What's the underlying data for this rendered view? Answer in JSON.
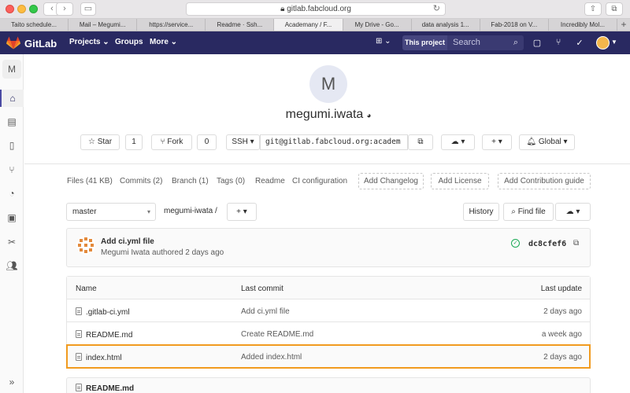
{
  "browser": {
    "url": "gitlab.fabcloud.org",
    "tabs": [
      {
        "label": "Taito schedule...",
        "active": false
      },
      {
        "label": "Mail – Megumi...",
        "active": false
      },
      {
        "label": "https://service...",
        "active": false
      },
      {
        "label": "Readme · Ssh...",
        "active": false
      },
      {
        "label": "Academany / F...",
        "active": true
      },
      {
        "label": "My Drive - Go...",
        "active": false
      },
      {
        "label": "data analysis 1...",
        "active": false
      },
      {
        "label": "Fab-2018 on V...",
        "active": false
      },
      {
        "label": "Incredibly Mol...",
        "active": false
      }
    ]
  },
  "header": {
    "brand": "GitLab",
    "nav": [
      "Projects ⌄",
      "Groups",
      "More ⌄"
    ],
    "scope": "This project",
    "search_placeholder": "Search"
  },
  "sidebar": {
    "avatar_letter": "M"
  },
  "project": {
    "avatar_letter": "M",
    "name": "megumi.iwata",
    "star_label": "Star",
    "star_count": "1",
    "fork_label": "Fork",
    "fork_count": "0",
    "protocol": "SSH",
    "clone_url": "git@gitlab.fabcloud.org:academ",
    "notification": "Global"
  },
  "stats": {
    "files": "Files (41 KB)",
    "commits": "Commits (2)",
    "branch": "Branch (1)",
    "tags": "Tags (0)",
    "readme": "Readme",
    "ci": "CI configuration",
    "add_changelog": "Add Changelog",
    "add_license": "Add License",
    "add_contribution": "Add Contribution guide"
  },
  "tree": {
    "branch": "master",
    "path": "megumi-iwata",
    "history": "History",
    "find_file": "Find file"
  },
  "commit": {
    "title": "Add ci.yml file",
    "meta": "Megumi Iwata authored 2 days ago",
    "sha": "dc8cfef6"
  },
  "table": {
    "headers": {
      "name": "Name",
      "last_commit": "Last commit",
      "last_update": "Last update"
    },
    "rows": [
      {
        "name": ".gitlab-ci.yml",
        "commit": "Add ci.yml file",
        "update": "2 days ago"
      },
      {
        "name": "README.md",
        "commit": "Create README.md",
        "update": "a week ago"
      },
      {
        "name": "index.html",
        "commit": "Added index.html",
        "update": "2 days ago"
      }
    ]
  },
  "readme": {
    "title": "README.md"
  },
  "colors": {
    "header_bg": "#292961",
    "highlight": "#f19b1f",
    "success": "#1aaa55"
  }
}
